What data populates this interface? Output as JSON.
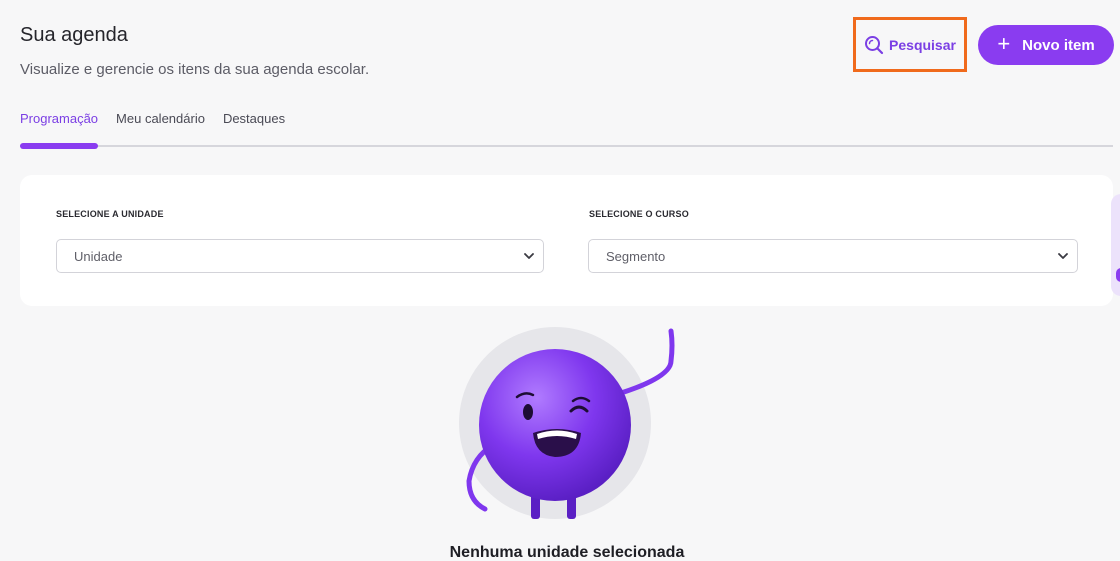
{
  "header": {
    "title": "Sua agenda",
    "subtitle": "Visualize e gerencie os itens da sua agenda escolar."
  },
  "actions": {
    "search_label": "Pesquisar",
    "new_item_label": "Novo item"
  },
  "tabs": [
    {
      "label": "Programação",
      "active": true
    },
    {
      "label": "Meu calendário",
      "active": false
    },
    {
      "label": "Destaques",
      "active": false
    }
  ],
  "filters": {
    "unit": {
      "label": "SELECIONE A UNIDADE",
      "value": "Unidade"
    },
    "course": {
      "label": "SELECIONE O CURSO",
      "value": "Segmento"
    }
  },
  "empty_state": {
    "title": "Nenhuma unidade selecionada"
  },
  "colors": {
    "accent": "#8a3cf0",
    "highlight_border": "#f06a1c"
  }
}
